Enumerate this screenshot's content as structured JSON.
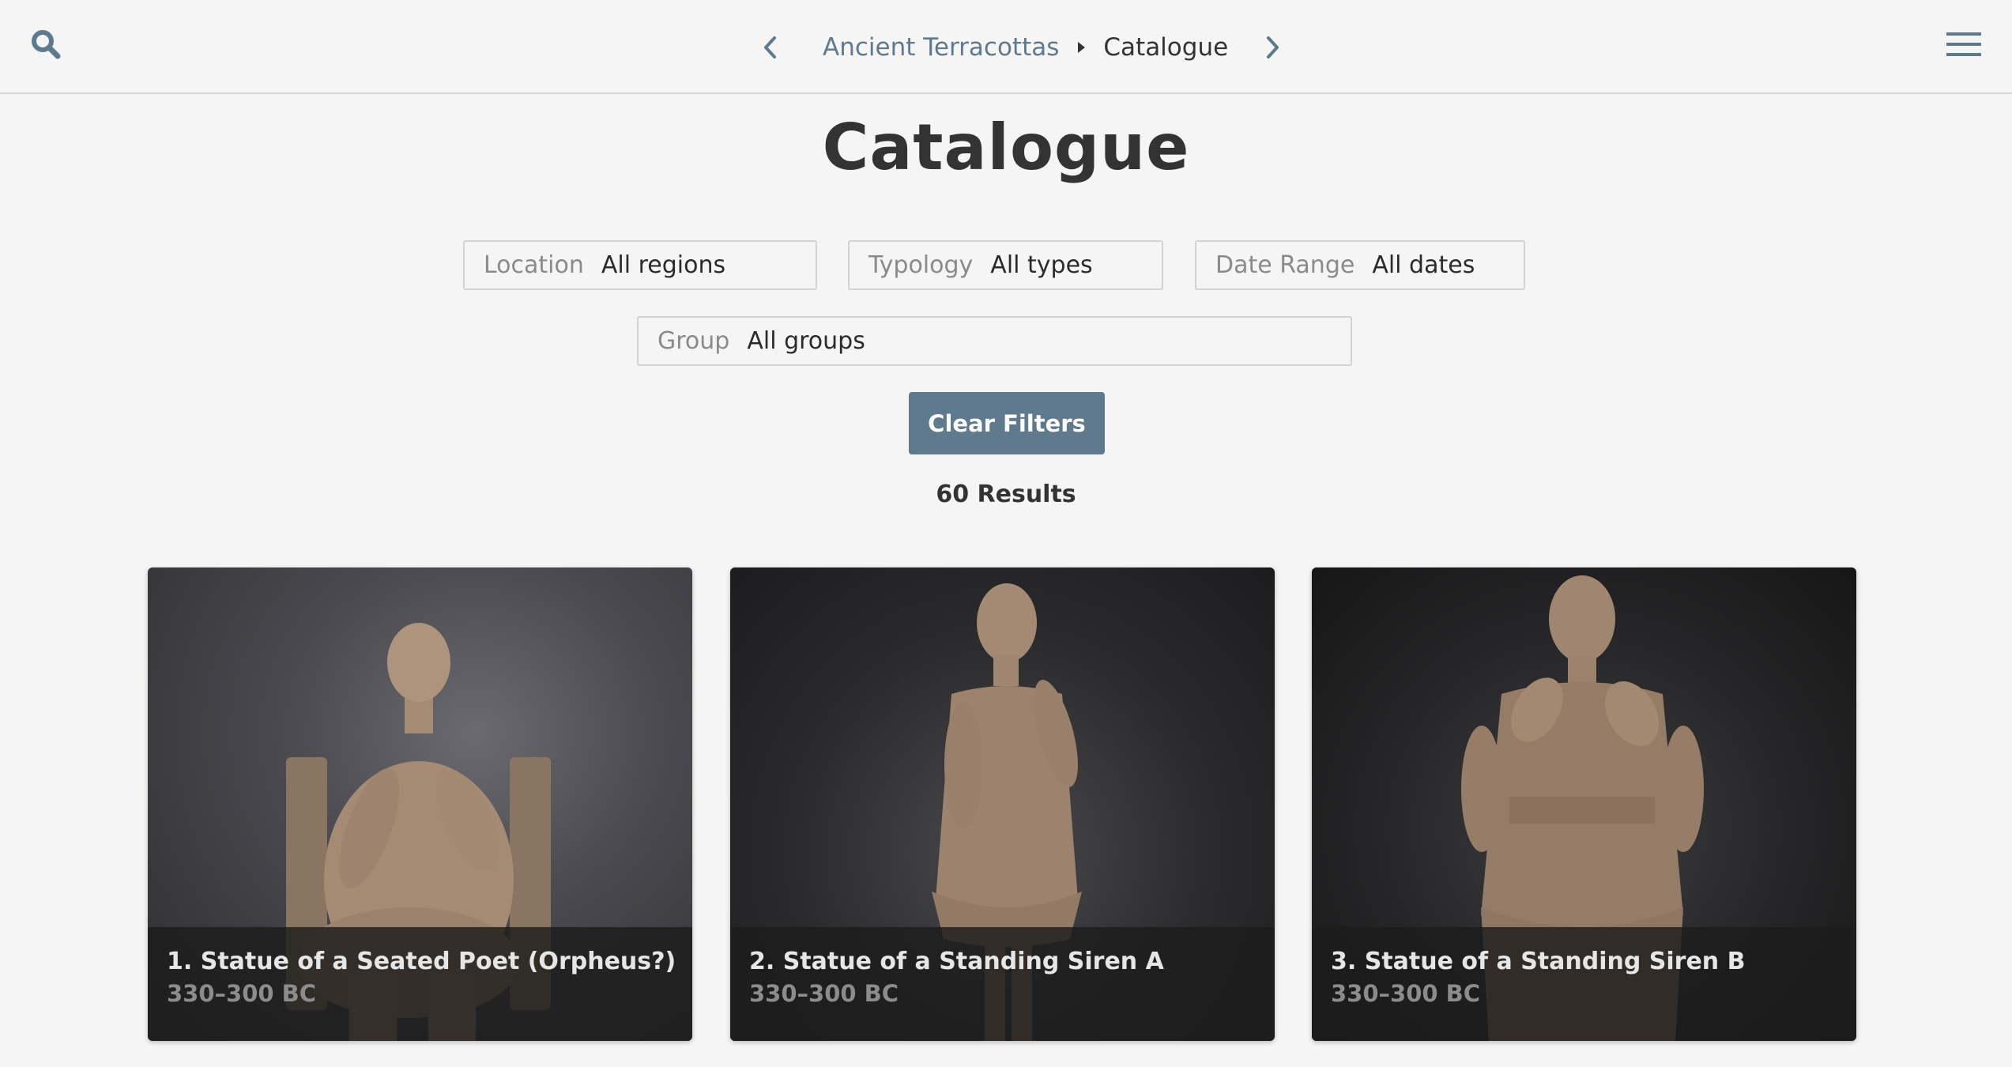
{
  "header": {
    "breadcrumb_parent": "Ancient Terracottas",
    "breadcrumb_current": "Catalogue",
    "icons": [
      "search-icon",
      "chevron-left-icon",
      "caret-right-icon",
      "chevron-right-icon",
      "hamburger-menu-icon"
    ]
  },
  "page": {
    "title": "Catalogue",
    "results": "60 Results"
  },
  "filters": {
    "location": {
      "label": "Location",
      "value": "All regions"
    },
    "typology": {
      "label": "Typology",
      "value": "All types"
    },
    "date_range": {
      "label": "Date Range",
      "value": "All dates"
    },
    "group": {
      "label": "Group",
      "value": "All groups"
    },
    "clear_label": "Clear Filters"
  },
  "cards": [
    {
      "title": "1. Statue of a Seated Poet (Orpheus?)",
      "date": "330–300 BC"
    },
    {
      "title": "2. Statue of a Standing Siren A",
      "date": "330–300 BC"
    },
    {
      "title": "3. Statue of a Standing Siren B",
      "date": "330–300 BC"
    }
  ],
  "colors": {
    "accent": "#5f7a8c",
    "background": "#f5f5f5",
    "text": "#333333"
  }
}
